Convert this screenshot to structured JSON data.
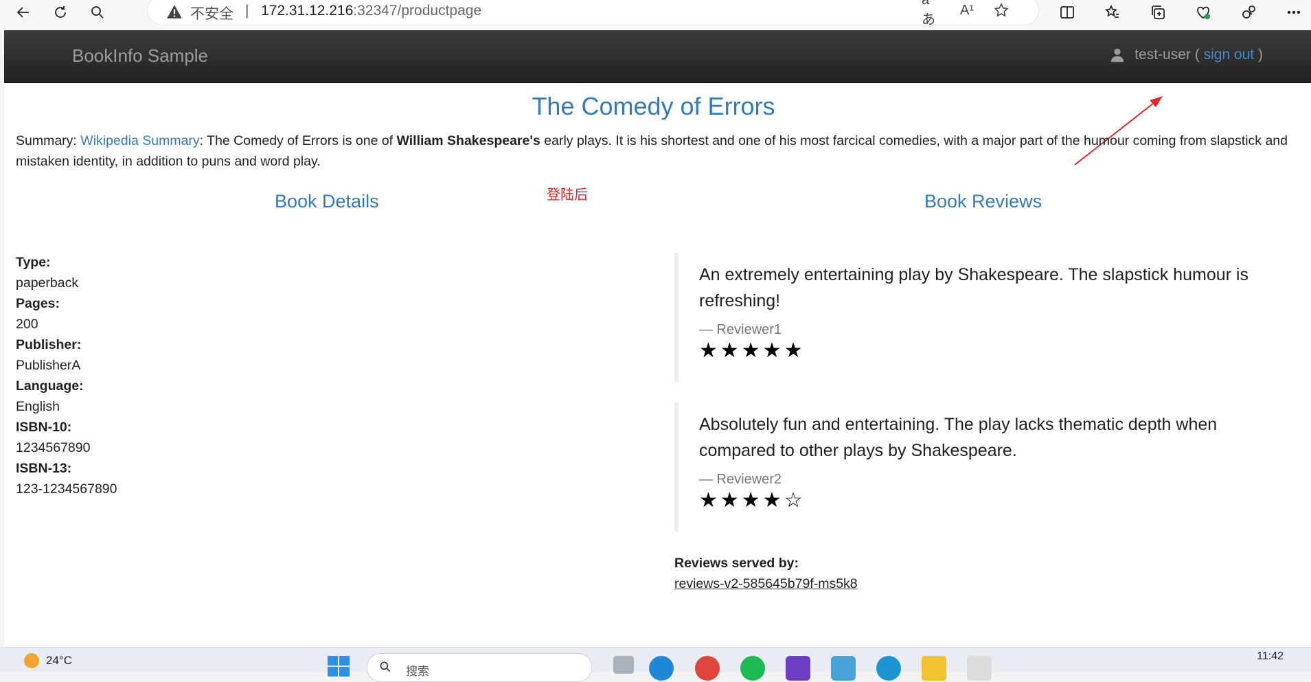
{
  "browser": {
    "security_label": "不安全",
    "separator": "|",
    "url_host": "172.31.12.216",
    "url_path": ":32347/productpage",
    "translate_icon_text": "aあ",
    "read_aloud_icon_text": "A¹"
  },
  "navbar": {
    "brand": "BookInfo Sample",
    "user": "test-user",
    "paren_open": "(",
    "sign_out": "sign out",
    "paren_close": ")"
  },
  "product": {
    "title": "The Comedy of Errors",
    "summary_label": "Summary:",
    "summary_link": "Wikipedia Summary",
    "summary_part1": ": The Comedy of Errors is one of ",
    "summary_bold": "William Shakespeare's",
    "summary_part2": " early plays. It is his shortest and one of his most farcical comedies, with a major part of the humour coming from slapstick and mistaken identity, in addition to puns and word play."
  },
  "annotation": {
    "label": "登陆后",
    "color": "#e3262a"
  },
  "details": {
    "heading": "Book Details",
    "items": [
      {
        "label": "Type:",
        "value": "paperback"
      },
      {
        "label": "Pages:",
        "value": "200"
      },
      {
        "label": "Publisher:",
        "value": "PublisherA"
      },
      {
        "label": "Language:",
        "value": "English"
      },
      {
        "label": "ISBN-10:",
        "value": "1234567890"
      },
      {
        "label": "ISBN-13:",
        "value": "123-1234567890"
      }
    ]
  },
  "reviews": {
    "heading": "Book Reviews",
    "items": [
      {
        "text": "An extremely entertaining play by Shakespeare. The slapstick humour is refreshing!",
        "reviewer": "— Reviewer1",
        "stars": "★★★★★",
        "rating": 5
      },
      {
        "text": "Absolutely fun and entertaining. The play lacks thematic depth when compared to other plays by Shakespeare.",
        "reviewer": "— Reviewer2",
        "stars": "★★★★☆",
        "rating": 4
      }
    ],
    "served_label": "Reviews served by:",
    "served_pod": "reviews-v2-585645b79f-ms5k8"
  },
  "taskbar": {
    "temperature": "24°C",
    "search_placeholder": "搜索",
    "time": "11:42"
  }
}
